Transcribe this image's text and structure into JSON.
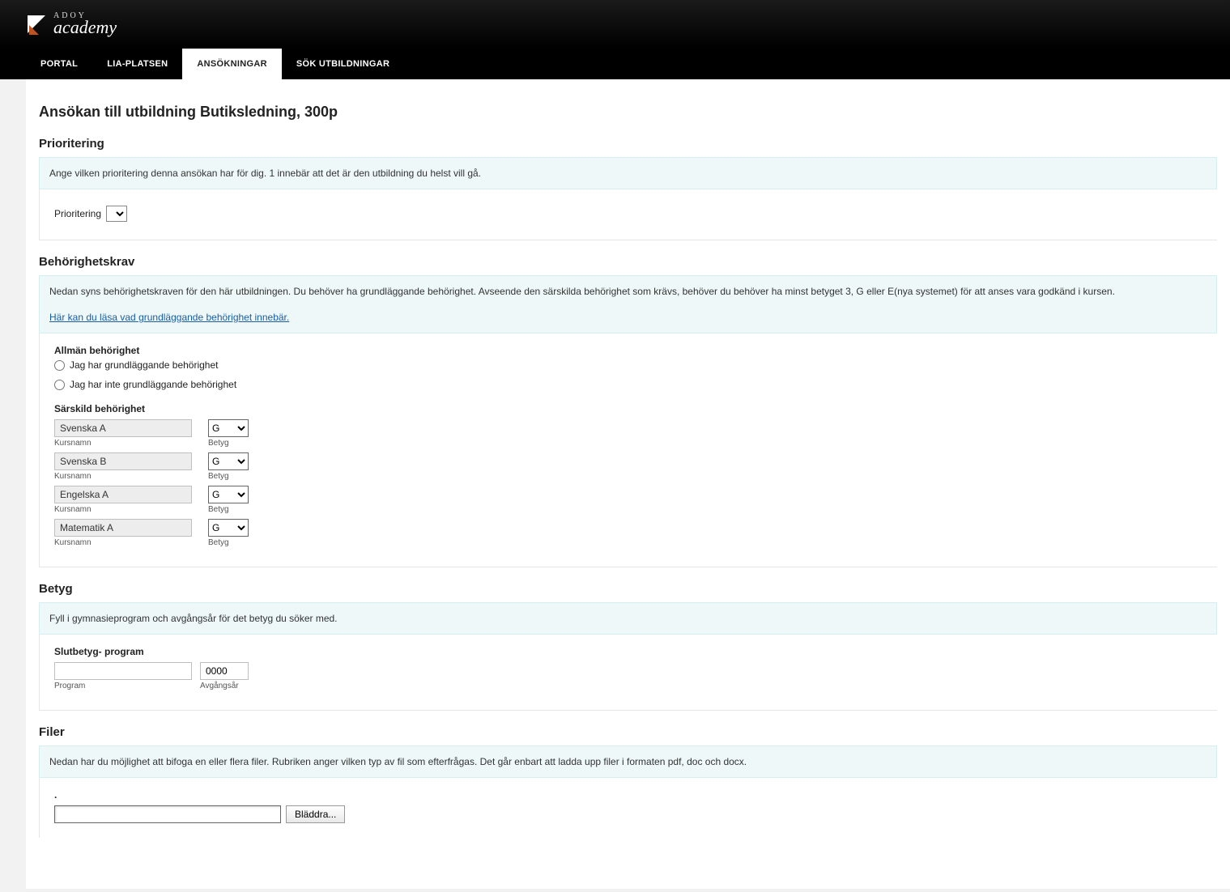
{
  "brand": {
    "line1": "ADOY",
    "line2": "academy"
  },
  "nav": {
    "items": [
      {
        "label": "PORTAL",
        "active": false
      },
      {
        "label": "LIA-PLATSEN",
        "active": false
      },
      {
        "label": "ANSÖKNINGAR",
        "active": true
      },
      {
        "label": "SÖK UTBILDNINGAR",
        "active": false
      }
    ]
  },
  "page_title": "Ansökan till utbildning Butiksledning, 300p",
  "prioritering": {
    "heading": "Prioritering",
    "info": "Ange vilken prioritering denna ansökan har för dig. 1 innebär att det är den utbildning du helst vill gå.",
    "label": "Prioritering",
    "selected_value": ""
  },
  "behorighet": {
    "heading": "Behörighetskrav",
    "info": "Nedan syns behörighetskraven för den här utbildningen. Du behöver ha grundläggande behörighet. Avseende den särskilda behörighet som krävs, behöver du behöver ha minst betyget 3, G eller E(nya systemet) för att anses vara godkänd i kursen.",
    "info_link": "Här kan du läsa vad grundläggande behörighet innebär.",
    "allman_label": "Allmän behörighet",
    "radio_yes": "Jag har grundläggande behörighet",
    "radio_no": "Jag har inte grundläggande behörighet",
    "sarskild_label": "Särskild behörighet",
    "kursnamn_label": "Kursnamn",
    "betyg_label": "Betyg",
    "courses": [
      {
        "name": "Svenska A",
        "grade": "G"
      },
      {
        "name": "Svenska B",
        "grade": "G"
      },
      {
        "name": "Engelska A",
        "grade": "G"
      },
      {
        "name": "Matematik A",
        "grade": "G"
      }
    ]
  },
  "betyg": {
    "heading": "Betyg",
    "info": "Fyll i gymnasieprogram och avgångsår för det betyg du söker med.",
    "slutbetyg_label": "Slutbetyg- program",
    "program_label": "Program",
    "program_value": "",
    "avgangsar_label": "Avgångsår",
    "avgangsar_value": "0000"
  },
  "filer": {
    "heading": "Filer",
    "info": "Nedan har du möjlighet att bifoga en eller flera filer. Rubriken anger vilken typ av fil som efterfrågas. Det går enbart att ladda upp filer i formaten pdf, doc och docx.",
    "dot": ".",
    "browse_label": "Bläddra...",
    "file_value": ""
  }
}
